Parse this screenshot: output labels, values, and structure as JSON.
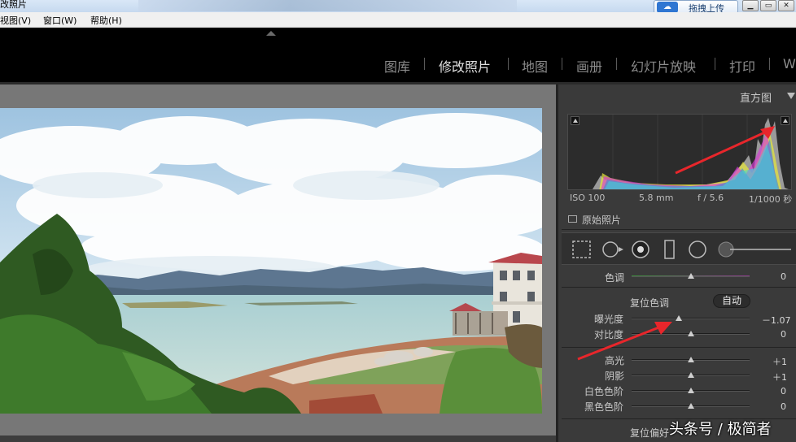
{
  "titlebar": {
    "title": "改照片",
    "upload_label": "拖拽上传",
    "upload_icon": "cloud-icon"
  },
  "menu": {
    "view": "视图(V)",
    "window": "窗口(W)",
    "help": "帮助(H)"
  },
  "modules": [
    {
      "label": "图库",
      "active": false
    },
    {
      "label": "修改照片",
      "active": true
    },
    {
      "label": "地图",
      "active": false
    },
    {
      "label": "画册",
      "active": false
    },
    {
      "label": "幻灯片放映",
      "active": false
    },
    {
      "label": "打印",
      "active": false
    },
    {
      "label": "W",
      "active": false
    }
  ],
  "histogram": {
    "title": "直方图",
    "iso": "ISO 100",
    "focal": "5.8 mm",
    "aperture": "f / 5.6",
    "shutter": "1/1000 秒",
    "original_label": "原始照片"
  },
  "tone": {
    "tint_label": "色调",
    "tint_value": "0",
    "reset_label": "复位色调",
    "auto_label": "自动",
    "sliders": [
      {
        "label": "曝光度",
        "value": "－1.07"
      },
      {
        "label": "对比度",
        "value": "0"
      },
      {
        "label": "高光",
        "value": "＋1"
      },
      {
        "label": "阴影",
        "value": "＋1"
      },
      {
        "label": "白色色阶",
        "value": "0"
      },
      {
        "label": "黑色色阶",
        "value": "0"
      }
    ],
    "presence_reset_label": "复位偏好"
  },
  "watermark": "头条号 / 极简者",
  "colors": {
    "accent_red": "#e8262b",
    "panel_bg": "#3a3a3a",
    "photo_bg": "#777777"
  }
}
